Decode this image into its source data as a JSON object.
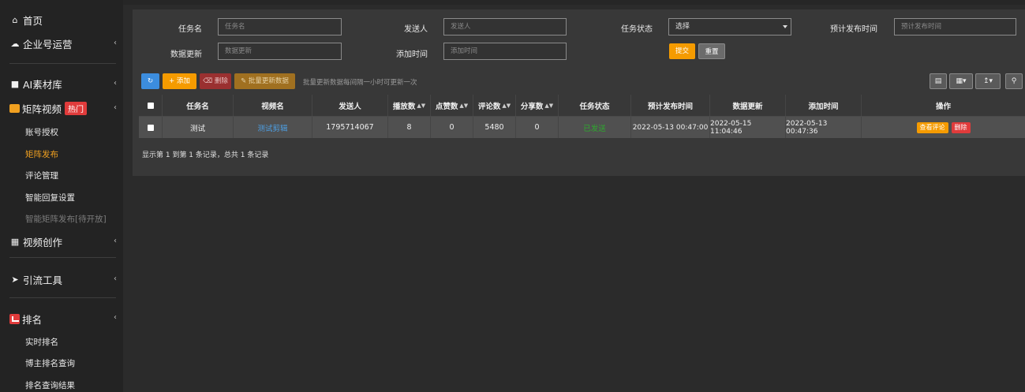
{
  "sidebar": {
    "home": "首页",
    "enterprise": "企业号运营",
    "ai_material": "AI素材库",
    "matrix_video": "矩阵视频",
    "hot_badge": "热门",
    "sub_items": [
      "账号授权",
      "矩阵发布",
      "评论管理",
      "智能回复设置",
      "智能矩阵发布[待开放]"
    ],
    "video_create": "视频创作",
    "traffic_tools": "引流工具",
    "ranking": "排名",
    "ranking_subs": [
      "实时排名",
      "博主排名查询",
      "排名查询结果"
    ]
  },
  "filters": {
    "task_name_label": "任务名",
    "task_name_placeholder": "任务名",
    "sender_label": "发送人",
    "sender_placeholder": "发送人",
    "status_label": "任务状态",
    "status_value": "选择",
    "plan_time_label": "预计发布时间",
    "plan_time_placeholder": "预计发布时间",
    "data_update_label": "数据更新",
    "data_update_placeholder": "数据更新",
    "add_time_label": "添加时间",
    "add_time_placeholder": "添加时间",
    "submit": "提交",
    "reset": "重置"
  },
  "toolbar": {
    "add": "+ 添加",
    "delete": "删除",
    "batch_update": "批量更新数据",
    "hint": "批量更新数据每间隔一小时可更新一次"
  },
  "table": {
    "headers": [
      "任务名",
      "视频名",
      "发送人",
      "播放数",
      "点赞数",
      "评论数",
      "分享数",
      "任务状态",
      "预计发布时间",
      "数据更新",
      "添加时间",
      "操作"
    ],
    "rows": [
      {
        "task_name": "测试",
        "video_name": "测试剪辑",
        "sender": "1795714067",
        "plays": "8",
        "likes": "0",
        "comments": "5480",
        "shares": "0",
        "status": "已发送",
        "plan_time": "2022-05-13 00:47:00",
        "data_update": "2022-05-15 11:04:46",
        "add_time": "2022-05-13 00:47:36",
        "op_view": "查看评论",
        "op_delete": "删除"
      }
    ]
  },
  "pager": "显示第 1 到第 1 条记录，总共 1 条记录",
  "colors": {
    "accent": "#f59b00",
    "danger": "#e03b3b",
    "link": "#4da0e6",
    "success": "#2ea82e"
  }
}
